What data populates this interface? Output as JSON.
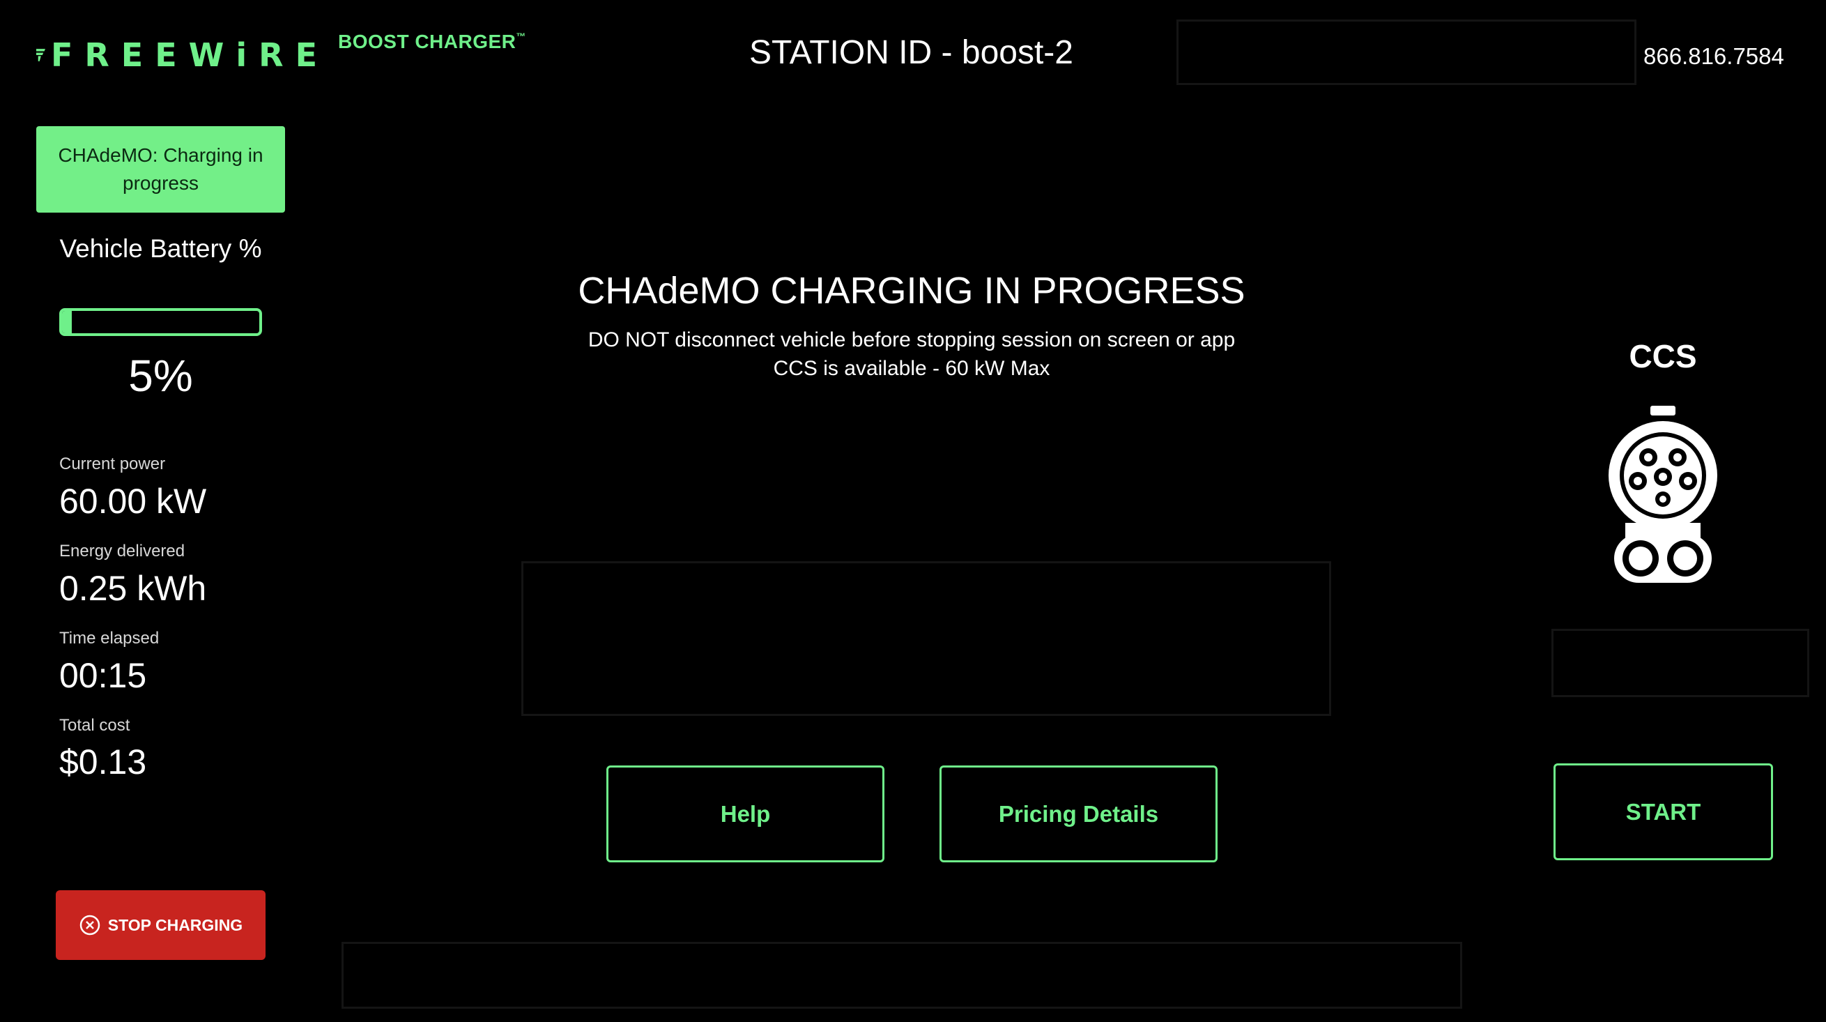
{
  "header": {
    "logo_text": "FREEWiRE",
    "product_name": "BOOST CHARGER",
    "product_trademark": "™",
    "station_id": "STATION ID - boost-2",
    "phone": "866.816.7584"
  },
  "left_panel": {
    "status_badge": "CHAdeMO: Charging in progress",
    "battery_label": "Vehicle Battery %",
    "battery_percent_value": 5,
    "battery_percent_text": "5%",
    "metrics": [
      {
        "label": "Current power",
        "value": "60.00 kW"
      },
      {
        "label": "Energy delivered",
        "value": "0.25 kWh"
      },
      {
        "label": "Time elapsed",
        "value": "00:15"
      },
      {
        "label": "Total cost",
        "value": "$0.13"
      }
    ],
    "stop_button": "STOP CHARGING"
  },
  "main": {
    "title": "CHAdeMO CHARGING IN PROGRESS",
    "warning": "DO NOT disconnect vehicle before stopping session on screen or app",
    "availability": "CCS is available - 60 kW Max",
    "help_button": "Help",
    "pricing_button": "Pricing Details"
  },
  "connector": {
    "label": "CCS",
    "icon": "ccs-plug-icon",
    "start_button": "START"
  },
  "colors": {
    "accent_green": "#6ff08a",
    "badge_green": "#73ef88",
    "stop_red": "#c8241f",
    "background": "#000000"
  }
}
